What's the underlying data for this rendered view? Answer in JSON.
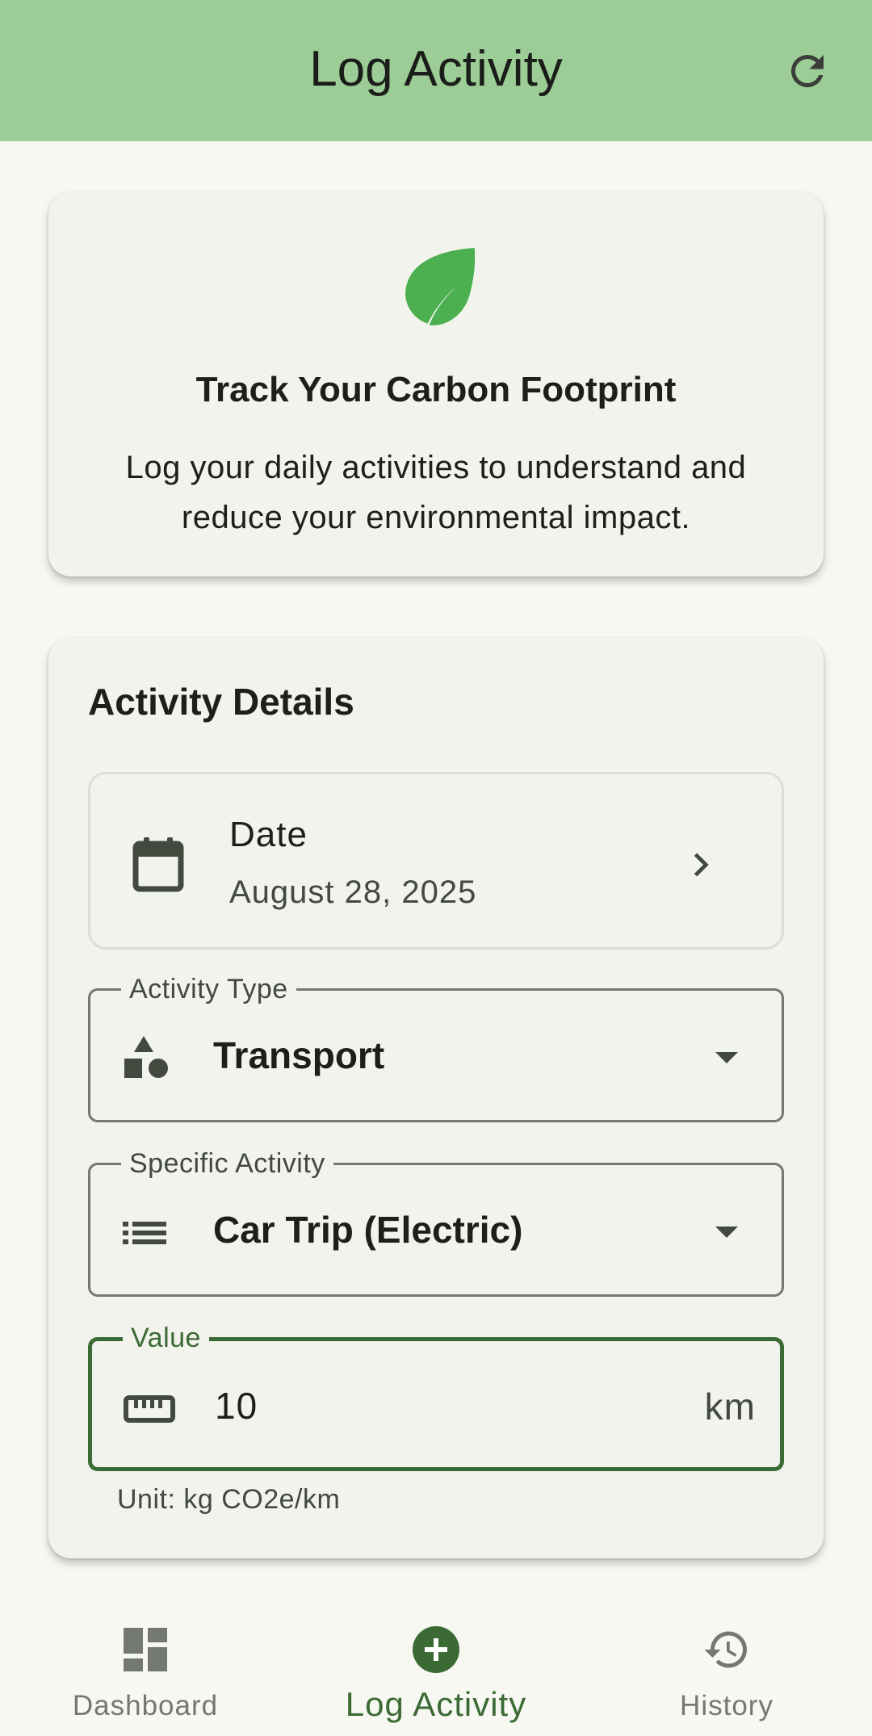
{
  "app_bar": {
    "title": "Log Activity",
    "refresh_icon": "refresh-icon"
  },
  "intro_card": {
    "icon": "leaf-icon",
    "title": "Track Your Carbon Footprint",
    "description": "Log your daily activities to understand and reduce your environmental impact."
  },
  "details_card": {
    "title": "Activity Details",
    "date": {
      "label": "Date",
      "value": "August 28, 2025",
      "icon": "calendar-icon"
    },
    "activity_type": {
      "label": "Activity Type",
      "value": "Transport",
      "icon": "category-icon"
    },
    "specific_activity": {
      "label": "Specific Activity",
      "value": "Car Trip (Electric)",
      "icon": "list-icon"
    },
    "value_field": {
      "label": "Value",
      "value": "10",
      "suffix": "km",
      "icon": "ruler-icon"
    },
    "helper": "Unit: kg CO2e/km"
  },
  "bottom_nav": {
    "items": [
      {
        "label": "Dashboard",
        "icon": "dashboard-icon",
        "active": false
      },
      {
        "label": "Log Activity",
        "icon": "add-circle-icon",
        "active": true
      },
      {
        "label": "History",
        "icon": "history-icon",
        "active": false
      }
    ]
  },
  "colors": {
    "app_bar": "#9ccd96",
    "accent": "#3c6a34",
    "leaf": "#4caf50",
    "background": "#f6f8f1",
    "card": "#f1f3ec"
  }
}
